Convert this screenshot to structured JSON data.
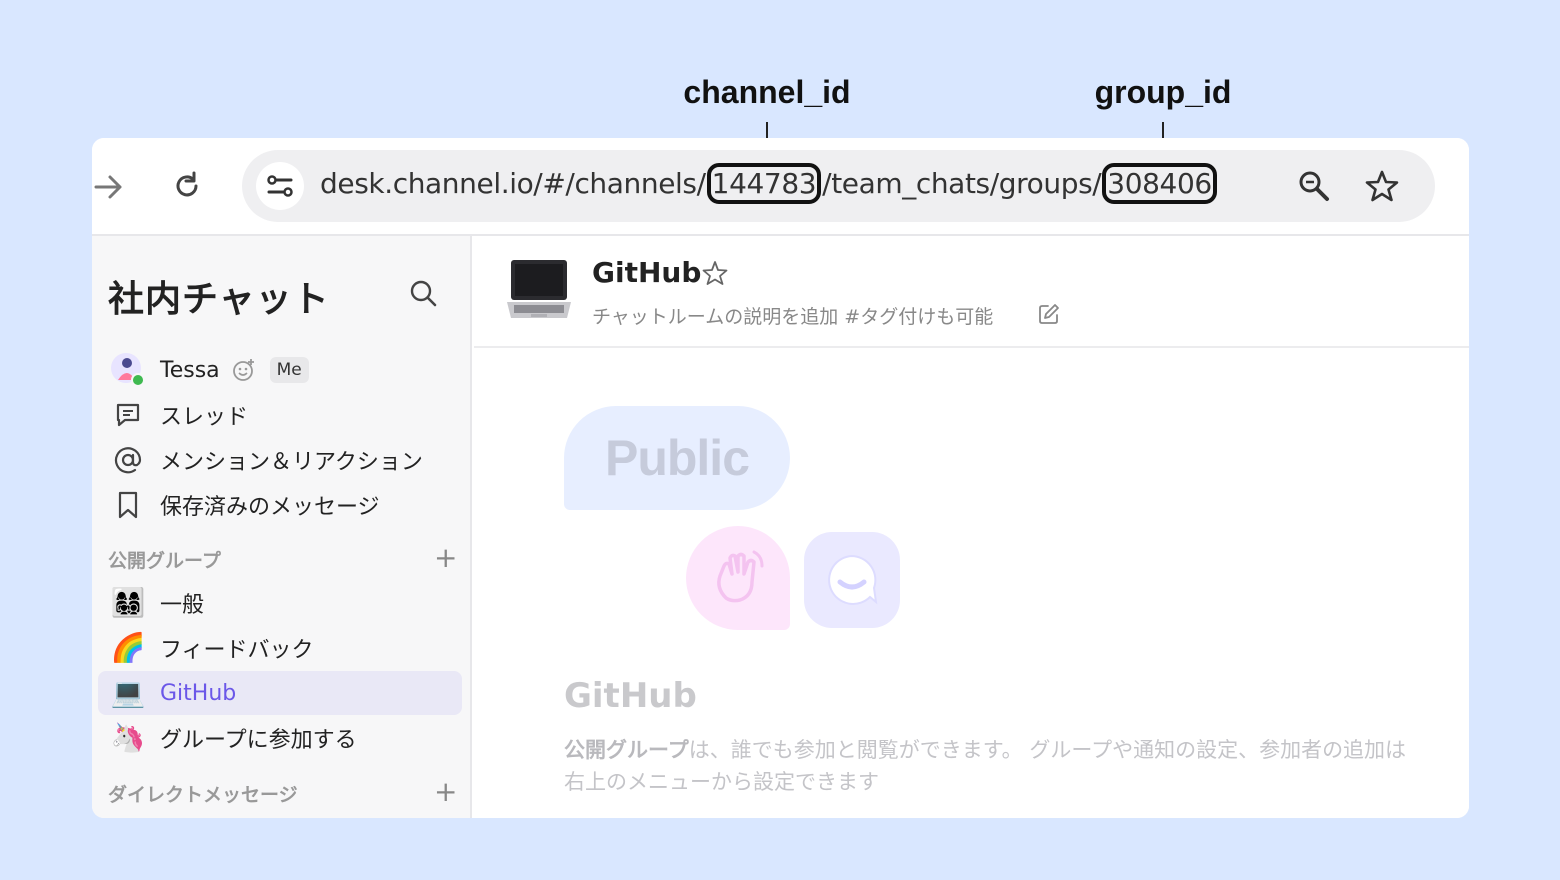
{
  "annotations": {
    "channel_id_label": "channel_id",
    "group_id_label": "group_id"
  },
  "browser": {
    "url_prefix": "desk.channel.io/#/channels/",
    "url_channel_id": "144783",
    "url_middle": "/team_chats/groups/",
    "url_group_id": "308406",
    "icons": [
      "forward-arrow-icon",
      "reload-icon",
      "site-info-icon",
      "zoom-icon",
      "bookmark-star-icon"
    ]
  },
  "sidebar": {
    "workspace_title": "社内チャット",
    "user": {
      "name": "Tessa",
      "badge": "Me",
      "status_color": "#3fb950"
    },
    "menu": [
      {
        "label": "スレッド",
        "icon": "thread-icon"
      },
      {
        "label": "メンション＆リアクション",
        "icon": "mention-icon"
      },
      {
        "label": "保存済みのメッセージ",
        "icon": "bookmark-icon"
      }
    ],
    "public_groups_heading": "公開グループ",
    "groups": [
      {
        "label": "一般",
        "emoji": "👩‍👩‍👧‍👦"
      },
      {
        "label": "フィードバック",
        "emoji": "🌈"
      },
      {
        "label": "GitHub",
        "emoji": "💻",
        "active": true
      },
      {
        "label": "グループに参加する",
        "emoji": "🦄"
      }
    ],
    "dm_heading": "ダイレクトメッセージ"
  },
  "channel": {
    "title": "GitHub",
    "description": "チャットルームの説明を追加 #タグ付けも可能",
    "public_label": "Public",
    "welcome_title": "GitHub",
    "welcome_bold": "公開グループ",
    "welcome_text": "は、誰でも参加と閲覧ができます。 グループや通知の設定、参加者の追加は右上のメニューから設定できます"
  },
  "colors": {
    "accent": "#6b57e8",
    "background": "#d9e7ff"
  }
}
